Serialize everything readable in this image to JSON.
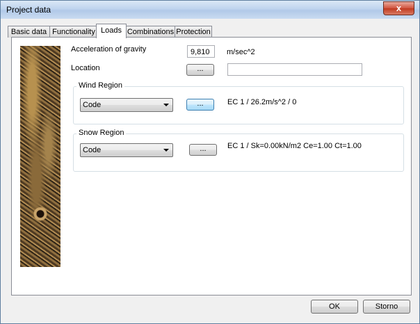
{
  "window": {
    "title": "Project data",
    "close_label": "x"
  },
  "tabs": [
    "Basic data",
    "Functionality",
    "Loads",
    "Combinations",
    "Protection"
  ],
  "gravity": {
    "label": "Acceleration of gravity",
    "value": "9,810",
    "unit": "m/sec^2"
  },
  "location": {
    "label": "Location",
    "button_label": "...",
    "value": ""
  },
  "wind": {
    "title": "Wind Region",
    "combo_value": "Code",
    "button_label": "...",
    "info": "EC 1 / 26.2m/s^2 / 0"
  },
  "snow": {
    "title": "Snow Region",
    "combo_value": "Code",
    "button_label": "...",
    "info": "EC 1 / Sk=0.00kN/m2 Ce=1.00 Ct=1.00"
  },
  "footer": {
    "ok_label": "OK",
    "cancel_label": "Storno"
  }
}
